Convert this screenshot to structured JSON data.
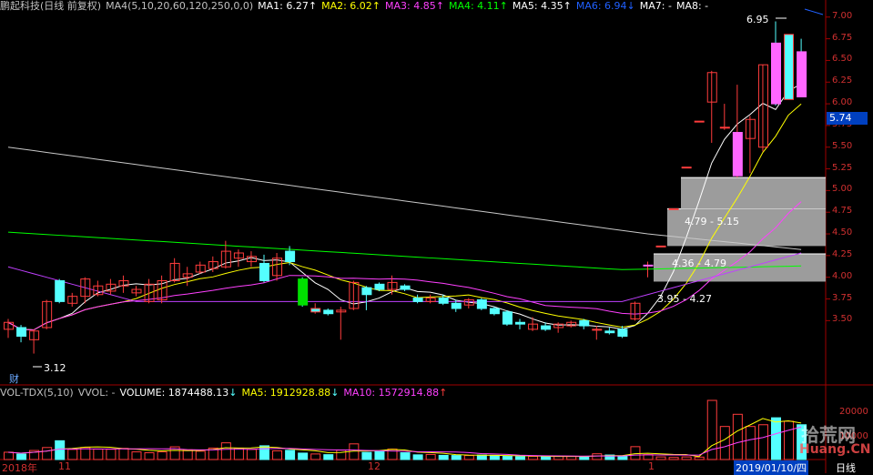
{
  "header": {
    "stock_name": "鹏起科技(日线 前复权)",
    "indicator": "MA4(5,10,20,60,120,250,0,0)",
    "ma_items": [
      {
        "label": "MA1: 6.27",
        "arrow": "↑",
        "color": "#ffffff"
      },
      {
        "label": "MA2: 6.02",
        "arrow": "↑",
        "color": "#ffff00"
      },
      {
        "label": "MA3: 4.85",
        "arrow": "↑",
        "color": "#ff40ff"
      },
      {
        "label": "MA4: 4.11",
        "arrow": "↑",
        "color": "#00ff00"
      },
      {
        "label": "MA5: 4.35",
        "arrow": "↑",
        "color": "#ffffff"
      },
      {
        "label": "MA6: 6.94",
        "arrow": "↓",
        "color": "#2060ff"
      },
      {
        "label": "MA7: -",
        "arrow": "",
        "color": "#ffffff"
      },
      {
        "label": "MA8: -",
        "arrow": "",
        "color": "#ffffff"
      }
    ]
  },
  "volume_header": {
    "name": "VOL-TDX(5,10)",
    "vvol": "VVOL: -",
    "volume": "VOLUME: 1874488.13",
    "volume_arrow": "↓",
    "ma5": "MA5: 1912928.88",
    "ma5_arrow": "↓",
    "ma10": "MA10: 1572914.88",
    "ma10_arrow": "↑"
  },
  "price_axis": [
    "7.00",
    "6.75",
    "6.50",
    "6.25",
    "6.00",
    "5.75",
    "5.50",
    "5.25",
    "5.00",
    "4.75",
    "4.50",
    "4.25",
    "4.00",
    "3.75",
    "3.50"
  ],
  "volume_axis": [
    "20000",
    "10000"
  ],
  "current_price": "5.74",
  "annotations": {
    "high": "6.95",
    "low": "3.12",
    "zone1": "3.95 - 4.27",
    "zone2": "4.36 - 4.79",
    "zone3": "4.79 - 5.15",
    "cai": "财"
  },
  "dates": {
    "d1": "2018年",
    "d2": "11",
    "d3": "12",
    "d4": "1",
    "d5": "2019/01/10/四",
    "d6": "日线"
  },
  "watermark": {
    "part1": "拾荒网",
    "part2": "Huang.CN"
  },
  "colors": {
    "up": "#ff3c3c",
    "down": "#54ffff",
    "bg": "#000000",
    "grid": "#a00000"
  },
  "chart_data": {
    "type": "candlestick",
    "ylim": [
      3.0,
      7.05
    ],
    "candles": [
      [
        3.4,
        3.48,
        3.3,
        3.52
      ],
      [
        3.42,
        3.32,
        3.25,
        3.45
      ],
      [
        3.28,
        3.38,
        3.12,
        3.4
      ],
      [
        3.42,
        3.72,
        3.4,
        3.74
      ],
      [
        3.96,
        3.72,
        3.7,
        3.98
      ],
      [
        3.7,
        3.78,
        3.66,
        3.82
      ],
      [
        3.78,
        3.98,
        3.7,
        4.0
      ],
      [
        3.8,
        3.9,
        3.78,
        3.96
      ],
      [
        3.84,
        3.92,
        3.8,
        3.98
      ],
      [
        3.9,
        3.96,
        3.82,
        4.02
      ],
      [
        3.82,
        3.86,
        3.78,
        3.9
      ],
      [
        3.72,
        3.92,
        3.7,
        3.98
      ],
      [
        3.74,
        3.96,
        3.7,
        4.02
      ],
      [
        3.96,
        4.16,
        3.94,
        4.22
      ],
      [
        4.0,
        4.04,
        3.9,
        4.12
      ],
      [
        4.06,
        4.14,
        4.04,
        4.18
      ],
      [
        4.1,
        4.18,
        4.06,
        4.24
      ],
      [
        4.12,
        4.3,
        4.1,
        4.42
      ],
      [
        4.22,
        4.28,
        4.12,
        4.32
      ],
      [
        4.18,
        4.24,
        4.12,
        4.3
      ],
      [
        4.16,
        3.96,
        3.94,
        4.26
      ],
      [
        4.02,
        4.22,
        3.96,
        4.28
      ],
      [
        4.3,
        4.18,
        4.14,
        4.36
      ],
      [
        3.98,
        3.68,
        3.66,
        4.0
      ],
      [
        3.6,
        3.64,
        3.58,
        3.7
      ],
      [
        3.62,
        3.58,
        3.56,
        3.64
      ],
      [
        3.6,
        3.62,
        3.28,
        3.66
      ],
      [
        3.64,
        3.94,
        3.62,
        3.96
      ],
      [
        3.88,
        3.8,
        3.62,
        3.9
      ],
      [
        3.92,
        3.86,
        3.84,
        3.94
      ],
      [
        3.86,
        3.94,
        3.8,
        4.02
      ],
      [
        3.9,
        3.86,
        3.84,
        3.92
      ],
      [
        3.76,
        3.72,
        3.7,
        3.8
      ],
      [
        3.72,
        3.76,
        3.7,
        3.8
      ],
      [
        3.76,
        3.7,
        3.68,
        3.8
      ],
      [
        3.7,
        3.64,
        3.6,
        3.74
      ],
      [
        3.68,
        3.74,
        3.64,
        3.76
      ],
      [
        3.74,
        3.64,
        3.62,
        3.76
      ],
      [
        3.64,
        3.58,
        3.56,
        3.66
      ],
      [
        3.6,
        3.46,
        3.44,
        3.62
      ],
      [
        3.48,
        3.46,
        3.4,
        3.52
      ],
      [
        3.4,
        3.46,
        3.38,
        3.54
      ],
      [
        3.44,
        3.4,
        3.38,
        3.48
      ],
      [
        3.42,
        3.46,
        3.36,
        3.48
      ],
      [
        3.44,
        3.48,
        3.42,
        3.5
      ],
      [
        3.5,
        3.44,
        3.4,
        3.52
      ],
      [
        3.4,
        3.4,
        3.28,
        3.44
      ],
      [
        3.38,
        3.36,
        3.34,
        3.42
      ],
      [
        3.4,
        3.32,
        3.3,
        3.44
      ],
      [
        3.52,
        3.7,
        3.5,
        3.72
      ],
      [
        4.14,
        4.14,
        4.0,
        4.18
      ],
      [
        4.36,
        4.36,
        4.36,
        4.36
      ],
      [
        4.79,
        4.79,
        4.79,
        4.79
      ],
      [
        5.27,
        5.27,
        5.27,
        5.27
      ],
      [
        5.8,
        5.8,
        5.8,
        5.8
      ],
      [
        6.02,
        6.36,
        5.55,
        6.38
      ],
      [
        5.73,
        5.73,
        5.7,
        6.0
      ],
      [
        5.17,
        5.67,
        5.15,
        6.22
      ],
      [
        5.6,
        5.82,
        5.2,
        5.86
      ],
      [
        5.5,
        6.45,
        5.45,
        6.45
      ],
      [
        6.7,
        6.0,
        5.98,
        6.95
      ],
      [
        6.05,
        6.8,
        6.05,
        6.8
      ],
      [
        6.6,
        6.08,
        6.08,
        6.75
      ]
    ],
    "volume": [
      4200,
      3100,
      5200,
      6900,
      10800,
      5800,
      6900,
      6000,
      5900,
      6400,
      4400,
      3900,
      4400,
      7300,
      5600,
      4800,
      6600,
      9600,
      6500,
      5800,
      7900,
      5000,
      5300,
      3700,
      3200,
      2800,
      5400,
      9000,
      4100,
      4600,
      6000,
      3900,
      2700,
      2900,
      2400,
      2300,
      2300,
      2600,
      2400,
      1800,
      1700,
      1800,
      1700,
      1800,
      1800,
      1600,
      3300,
      2600,
      1900,
      7400,
      2800,
      1500,
      1200,
      1500,
      1400,
      34000,
      19000,
      26000,
      19000,
      20000,
      24000,
      22000,
      20000
    ]
  }
}
